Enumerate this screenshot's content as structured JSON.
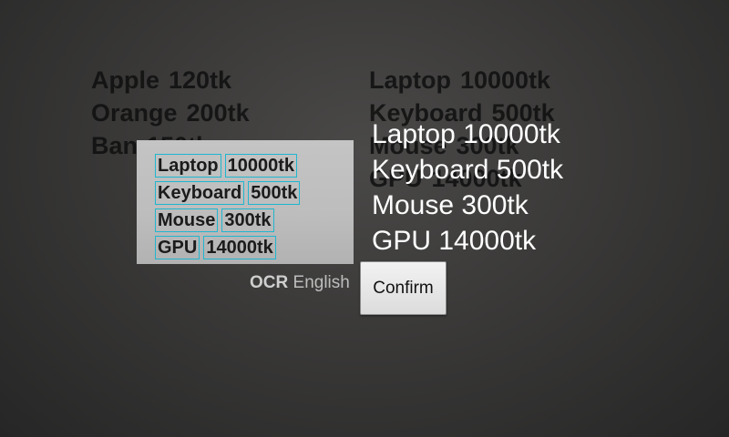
{
  "camera_background": {
    "left_list": [
      {
        "item": "Apple",
        "price": "120tk"
      },
      {
        "item": "Orange",
        "price": "200tk"
      },
      {
        "item": "Ban",
        "price": "150tk"
      }
    ],
    "right_list": [
      {
        "item": "Laptop",
        "price": "10000tk"
      },
      {
        "item": "Keyboard",
        "price": "500tk"
      },
      {
        "item": "Mouse",
        "price": "300tk"
      },
      {
        "item": "GPU",
        "price": "14000tk"
      }
    ]
  },
  "crop_preview": {
    "lines": [
      {
        "word": "Laptop",
        "amount": "10000tk"
      },
      {
        "word": "Keyboard",
        "amount": "500tk"
      },
      {
        "word": "Mouse",
        "amount": "300tk"
      },
      {
        "word": "GPU",
        "amount": "14000tk"
      }
    ]
  },
  "ocr_result": {
    "lines": [
      "Laptop 10000tk",
      "Keyboard 500tk",
      "Mouse 300tk",
      "GPU 14000tk"
    ]
  },
  "ocr_label": {
    "prefix": "OCR",
    "language": "English"
  },
  "confirm_button": {
    "label": "Confirm"
  }
}
